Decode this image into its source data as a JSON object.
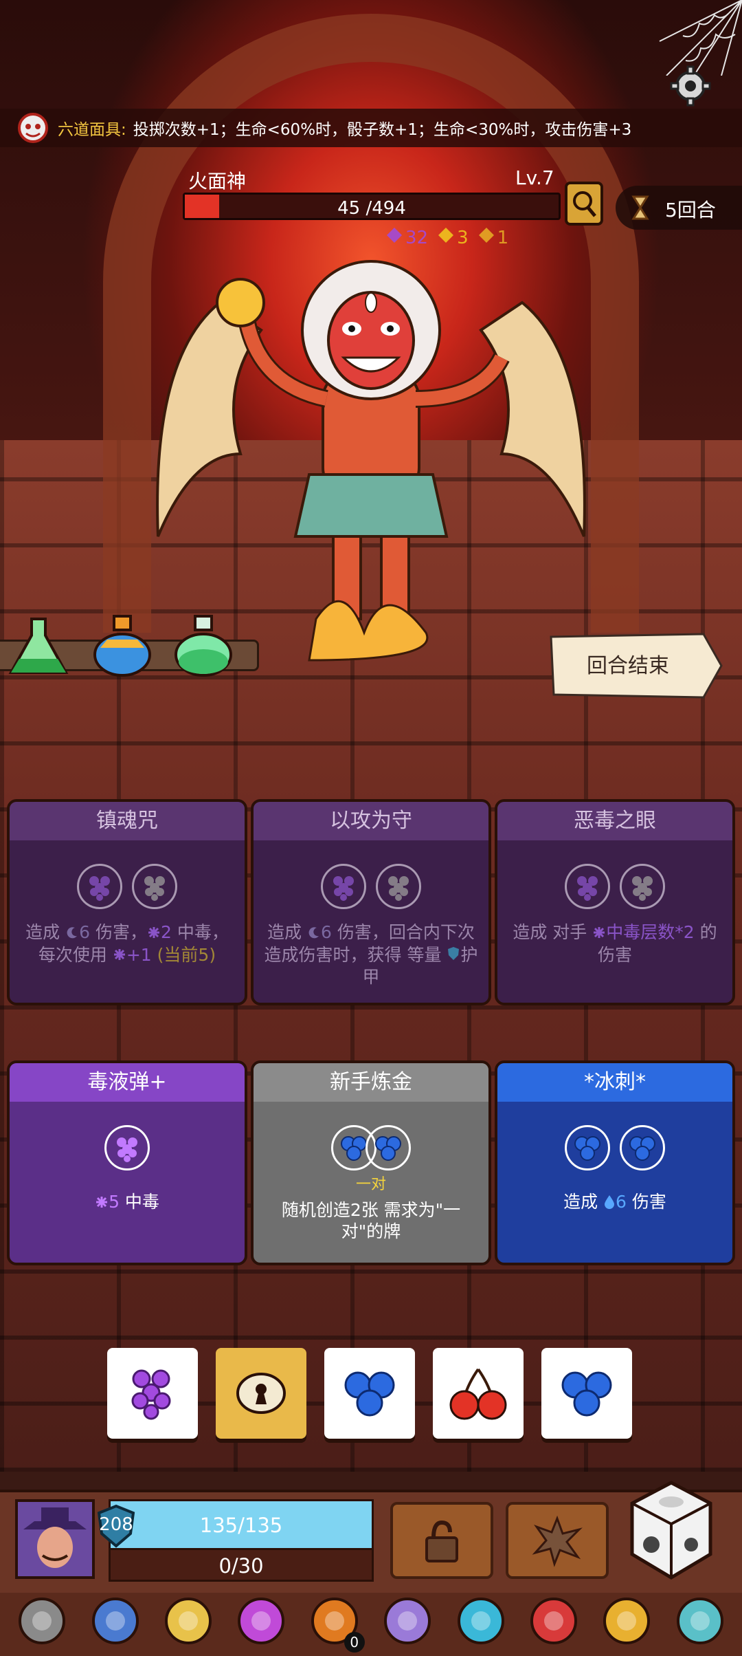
{
  "relic_banner": {
    "name": "六道面具:",
    "description": "投掷次数+1；生命<60%时，骰子数+1；生命<30%时，攻击伤害+3"
  },
  "enemy": {
    "name": "火面神",
    "level": "Lv.7",
    "hp_current": "45",
    "hp_max": "/494",
    "hp_fraction": 0.091,
    "statuses": [
      {
        "icon": "poison-icon",
        "value": "32",
        "color": "#a14bd8"
      },
      {
        "icon": "strength-icon",
        "value": "3",
        "color": "#f0c31e"
      },
      {
        "icon": "armor-icon",
        "value": "1",
        "color": "#e5a825"
      }
    ]
  },
  "turn": {
    "label": "5回合"
  },
  "end_turn_button": {
    "label": "回合结束"
  },
  "enemy_cards": [
    {
      "title": "镇魂咒",
      "parts": [
        {
          "t": "造成 "
        },
        {
          "t": "6",
          "c": "#7a68a0",
          "icon": "moon"
        },
        {
          "t": " 伤害，"
        },
        {
          "t": "2",
          "c": "#8a54c8",
          "icon": "poison"
        },
        {
          "t": " 中毒，每次使用 "
        },
        {
          "t": "+1",
          "c": "#8a54c8",
          "icon": "poison"
        },
        {
          "t": " (当前5)",
          "c": "#a38836"
        }
      ]
    },
    {
      "title": "以攻为守",
      "parts": [
        {
          "t": "造成 "
        },
        {
          "t": "6",
          "c": "#7a68a0",
          "icon": "moon"
        },
        {
          "t": " 伤害，回合内下次造成伤害时，获得 等量 "
        },
        {
          "t": "护甲",
          "icon": "shield"
        }
      ]
    },
    {
      "title": "恶毒之眼",
      "parts": [
        {
          "t": "造成 对手 "
        },
        {
          "t": "中毒层数*2",
          "c": "#8a54c8",
          "icon": "poison"
        },
        {
          "t": " 的伤害"
        }
      ]
    }
  ],
  "player_cards": [
    {
      "title": "毒液弹+",
      "parts": [
        {
          "t": "5",
          "c": "#c27aff",
          "icon": "poison"
        },
        {
          "t": " 中毒"
        }
      ]
    },
    {
      "title": "新手炼金",
      "requirement": "一对",
      "parts": [
        {
          "t": "随机创造2张 需求为\"一对\"的牌"
        }
      ]
    },
    {
      "title": "*冰刺*",
      "parts": [
        {
          "t": "造成 "
        },
        {
          "t": "6",
          "c": "#58a8ff",
          "icon": "drop"
        },
        {
          "t": " 伤害"
        }
      ]
    }
  ],
  "dice_tray": [
    "grape",
    "locked",
    "blueberry",
    "cherry",
    "blueberry"
  ],
  "player": {
    "armor": "208",
    "hp": "135/135",
    "xp": "0/30"
  },
  "relics": [
    {
      "name": "spiral-shell-icon"
    },
    {
      "name": "crystal-sword-icon"
    },
    {
      "name": "eye-amulet-icon"
    },
    {
      "name": "poison-splash-icon"
    },
    {
      "name": "fire-mask-icon",
      "count": "0"
    },
    {
      "name": "moon-icon"
    },
    {
      "name": "blue-gem-icon"
    },
    {
      "name": "red-crystal-icon"
    },
    {
      "name": "treasure-chest-icon"
    },
    {
      "name": "ghost-icon"
    }
  ]
}
